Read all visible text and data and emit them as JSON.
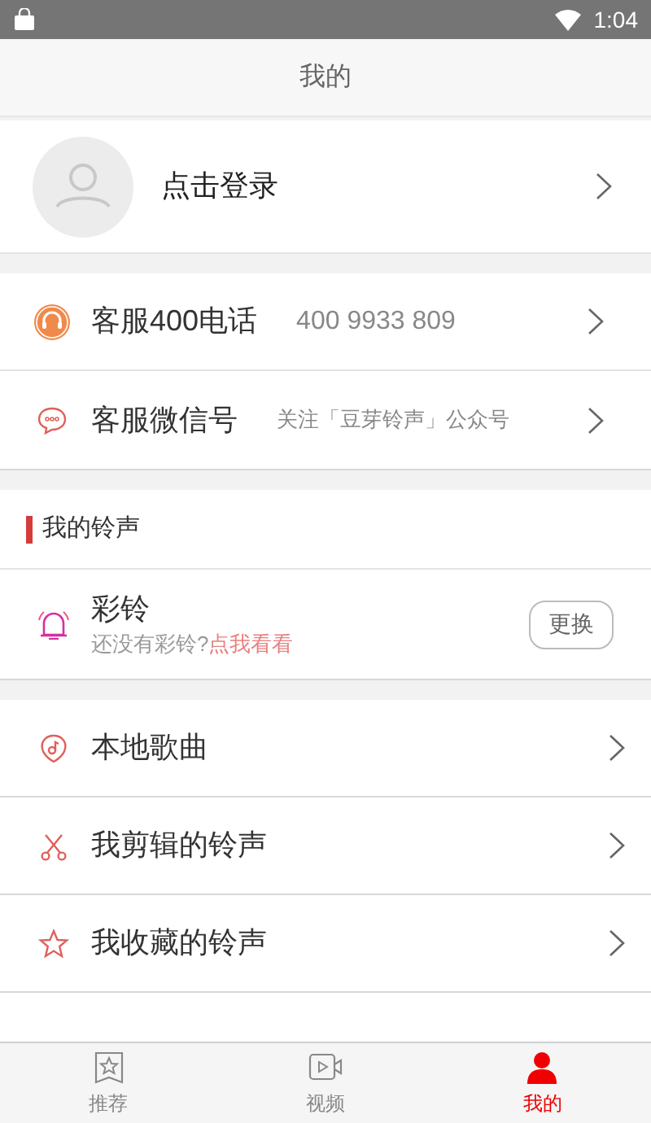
{
  "status_bar": {
    "time": "1:04"
  },
  "header": {
    "title": "我的"
  },
  "profile": {
    "label": "点击登录"
  },
  "service_rows": [
    {
      "label": "客服400电话",
      "detail": "400 9933 809",
      "kind": "phone"
    },
    {
      "label": "客服微信号",
      "detail": "关注「豆芽铃声」公众号",
      "kind": "wechat"
    }
  ],
  "ringtone_section": {
    "title": "我的铃声",
    "item": {
      "title": "彩铃",
      "hint": "还没有彩铃?",
      "link": "点我看看",
      "button": "更换"
    }
  },
  "menu_items": [
    {
      "label": "本地歌曲"
    },
    {
      "label": "我剪辑的铃声"
    },
    {
      "label": "我收藏的铃声"
    }
  ],
  "tabs": [
    {
      "label": "推荐",
      "selected": false
    },
    {
      "label": "视频",
      "selected": false
    },
    {
      "label": "我的",
      "selected": true
    }
  ]
}
